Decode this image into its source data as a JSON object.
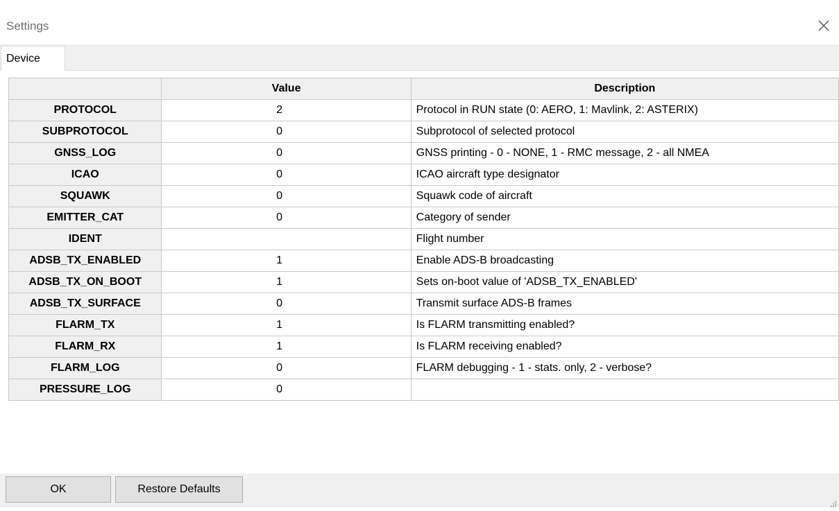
{
  "window": {
    "title": "Settings"
  },
  "tabs": [
    {
      "label": "Device"
    }
  ],
  "table": {
    "columns": [
      "",
      "Value",
      "Description"
    ],
    "rows": [
      {
        "name": "PROTOCOL",
        "value": "2",
        "description": "Protocol in RUN state (0: AERO, 1: Mavlink, 2: ASTERIX)"
      },
      {
        "name": "SUBPROTOCOL",
        "value": "0",
        "description": "Subprotocol of selected protocol"
      },
      {
        "name": "GNSS_LOG",
        "value": "0",
        "description": "GNSS printing - 0 - NONE, 1 - RMC message, 2 - all NMEA"
      },
      {
        "name": "ICAO",
        "value": "0",
        "description": "ICAO aircraft type designator"
      },
      {
        "name": "SQUAWK",
        "value": "0",
        "description": "Squawk code of aircraft"
      },
      {
        "name": "EMITTER_CAT",
        "value": "0",
        "description": "Category of sender"
      },
      {
        "name": "IDENT",
        "value": "",
        "description": "Flight number"
      },
      {
        "name": "ADSB_TX_ENABLED",
        "value": "1",
        "description": "Enable ADS-B broadcasting"
      },
      {
        "name": "ADSB_TX_ON_BOOT",
        "value": "1",
        "description": "Sets on-boot value of 'ADSB_TX_ENABLED'"
      },
      {
        "name": "ADSB_TX_SURFACE",
        "value": "0",
        "description": "Transmit surface ADS-B frames"
      },
      {
        "name": "FLARM_TX",
        "value": "1",
        "description": "Is FLARM transmitting enabled?"
      },
      {
        "name": "FLARM_RX",
        "value": "1",
        "description": "Is FLARM receiving enabled?"
      },
      {
        "name": "FLARM_LOG",
        "value": "0",
        "description": "FLARM debugging - 1 - stats. only, 2 - verbose?"
      },
      {
        "name": "PRESSURE_LOG",
        "value": "0",
        "description": ""
      }
    ]
  },
  "buttons": {
    "ok": "OK",
    "restore_defaults": "Restore Defaults"
  },
  "icons": {
    "close": "close-icon",
    "resize": "resize-grip-icon"
  },
  "colors": {
    "header_bg": "#f0f0f0",
    "grid_line": "#c8c8c8",
    "button_bg": "#e1e1e1"
  }
}
